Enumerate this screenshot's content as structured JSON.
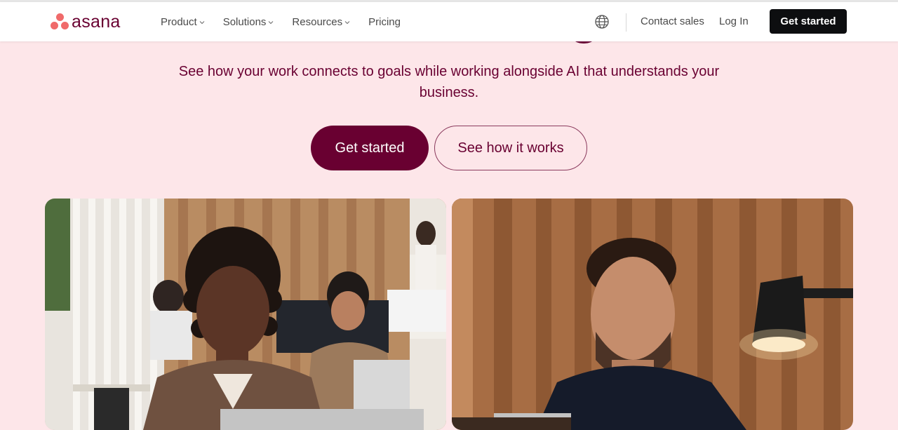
{
  "header": {
    "logo_text": "asana",
    "nav": [
      {
        "label": "Product",
        "has_dropdown": true
      },
      {
        "label": "Solutions",
        "has_dropdown": true
      },
      {
        "label": "Resources",
        "has_dropdown": true
      },
      {
        "label": "Pricing",
        "has_dropdown": false
      }
    ],
    "language_icon": "globe-icon",
    "contact_sales": "Contact sales",
    "log_in": "Log In",
    "get_started": "Get started"
  },
  "hero": {
    "subtitle": "See how your work connects to goals while working alongside AI that understands your business.",
    "primary_cta": "Get started",
    "secondary_cta": "See how it works"
  },
  "colors": {
    "hero_background": "#fde6e9",
    "brand_plum": "#690031",
    "logo_coral": "#f06a6a",
    "header_cta": "#0d0e10"
  },
  "images": [
    {
      "name": "photo-woman-at-laptop"
    },
    {
      "name": "photo-man-at-laptop"
    }
  ]
}
